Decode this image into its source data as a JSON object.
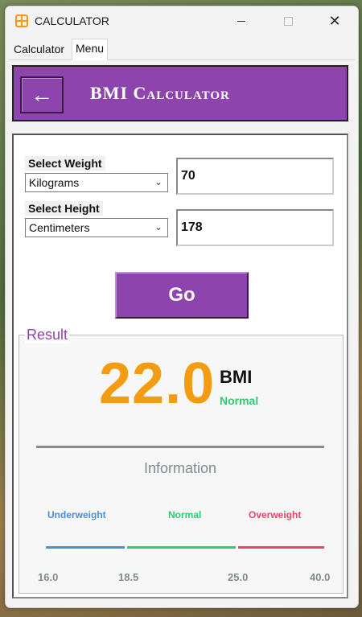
{
  "window": {
    "title": "CALCULATOR"
  },
  "tabs": [
    "Calculator",
    "Menu"
  ],
  "header": {
    "back_label": "←",
    "title": "BMI Calculator"
  },
  "form": {
    "weight_label": "Select Weight",
    "weight_unit": "Kilograms",
    "weight_value": "70",
    "height_label": "Select Height",
    "height_unit": "Centimeters",
    "height_value": "178",
    "go_label": "Go"
  },
  "result": {
    "legend": "Result",
    "bmi_value": "22.0",
    "bmi_unit": "BMI",
    "status": "Normal",
    "info_title": "Information",
    "ranges": [
      {
        "label": "Underweight",
        "color": "#4a90d9"
      },
      {
        "label": "Normal",
        "color": "#2ecc71"
      },
      {
        "label": "Overweight",
        "color": "#e8456a"
      }
    ],
    "ticks": [
      "16.0",
      "18.5",
      "25.0",
      "40.0"
    ]
  },
  "colors": {
    "accent": "#8e44ad",
    "bmi_value": "#f39c12",
    "normal": "#2ecc71"
  }
}
